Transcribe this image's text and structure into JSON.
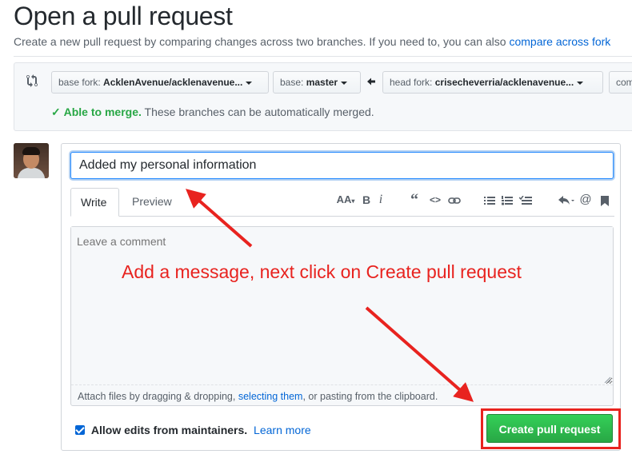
{
  "header": {
    "title": "Open a pull request",
    "subtitle": "Create a new pull request by comparing changes across two branches. If you need to, you can also",
    "subtitle_link": "compare across fork"
  },
  "compare": {
    "base_fork_label": "base fork:",
    "base_fork_value": "AcklenAvenue/acklenavenue...",
    "base_label": "base:",
    "base_value": "master",
    "head_fork_label": "head fork:",
    "head_fork_value": "crisecheverria/acklenavenue...",
    "compare_partial": "com",
    "merge_ok": "Able to merge.",
    "merge_text": "These branches can be automatically merged."
  },
  "form": {
    "title_value": "Added my personal information",
    "tabs": {
      "write": "Write",
      "preview": "Preview"
    },
    "comment_placeholder": "Leave a comment",
    "attach_prefix": "Attach files by dragging & dropping,",
    "attach_link": "selecting them",
    "attach_suffix": ", or pasting from the clipboard.",
    "allow_edits_label": "Allow edits from maintainers.",
    "allow_edits_checked": true,
    "learn_more": "Learn more",
    "create_button": "Create pull request"
  },
  "toolbar": {
    "header_glyph": "AA",
    "bold_glyph": "B",
    "italic_glyph": "i",
    "quote_glyph": "“",
    "code_glyph": "<>",
    "mention_glyph": "@"
  },
  "annotation": {
    "text": "Add a message, next click on Create pull request",
    "color": "#e8231f"
  },
  "colors": {
    "link": "#0366d6",
    "success": "#28a745",
    "button_green": "#2ea44f",
    "focus_border": "#2188ff"
  }
}
